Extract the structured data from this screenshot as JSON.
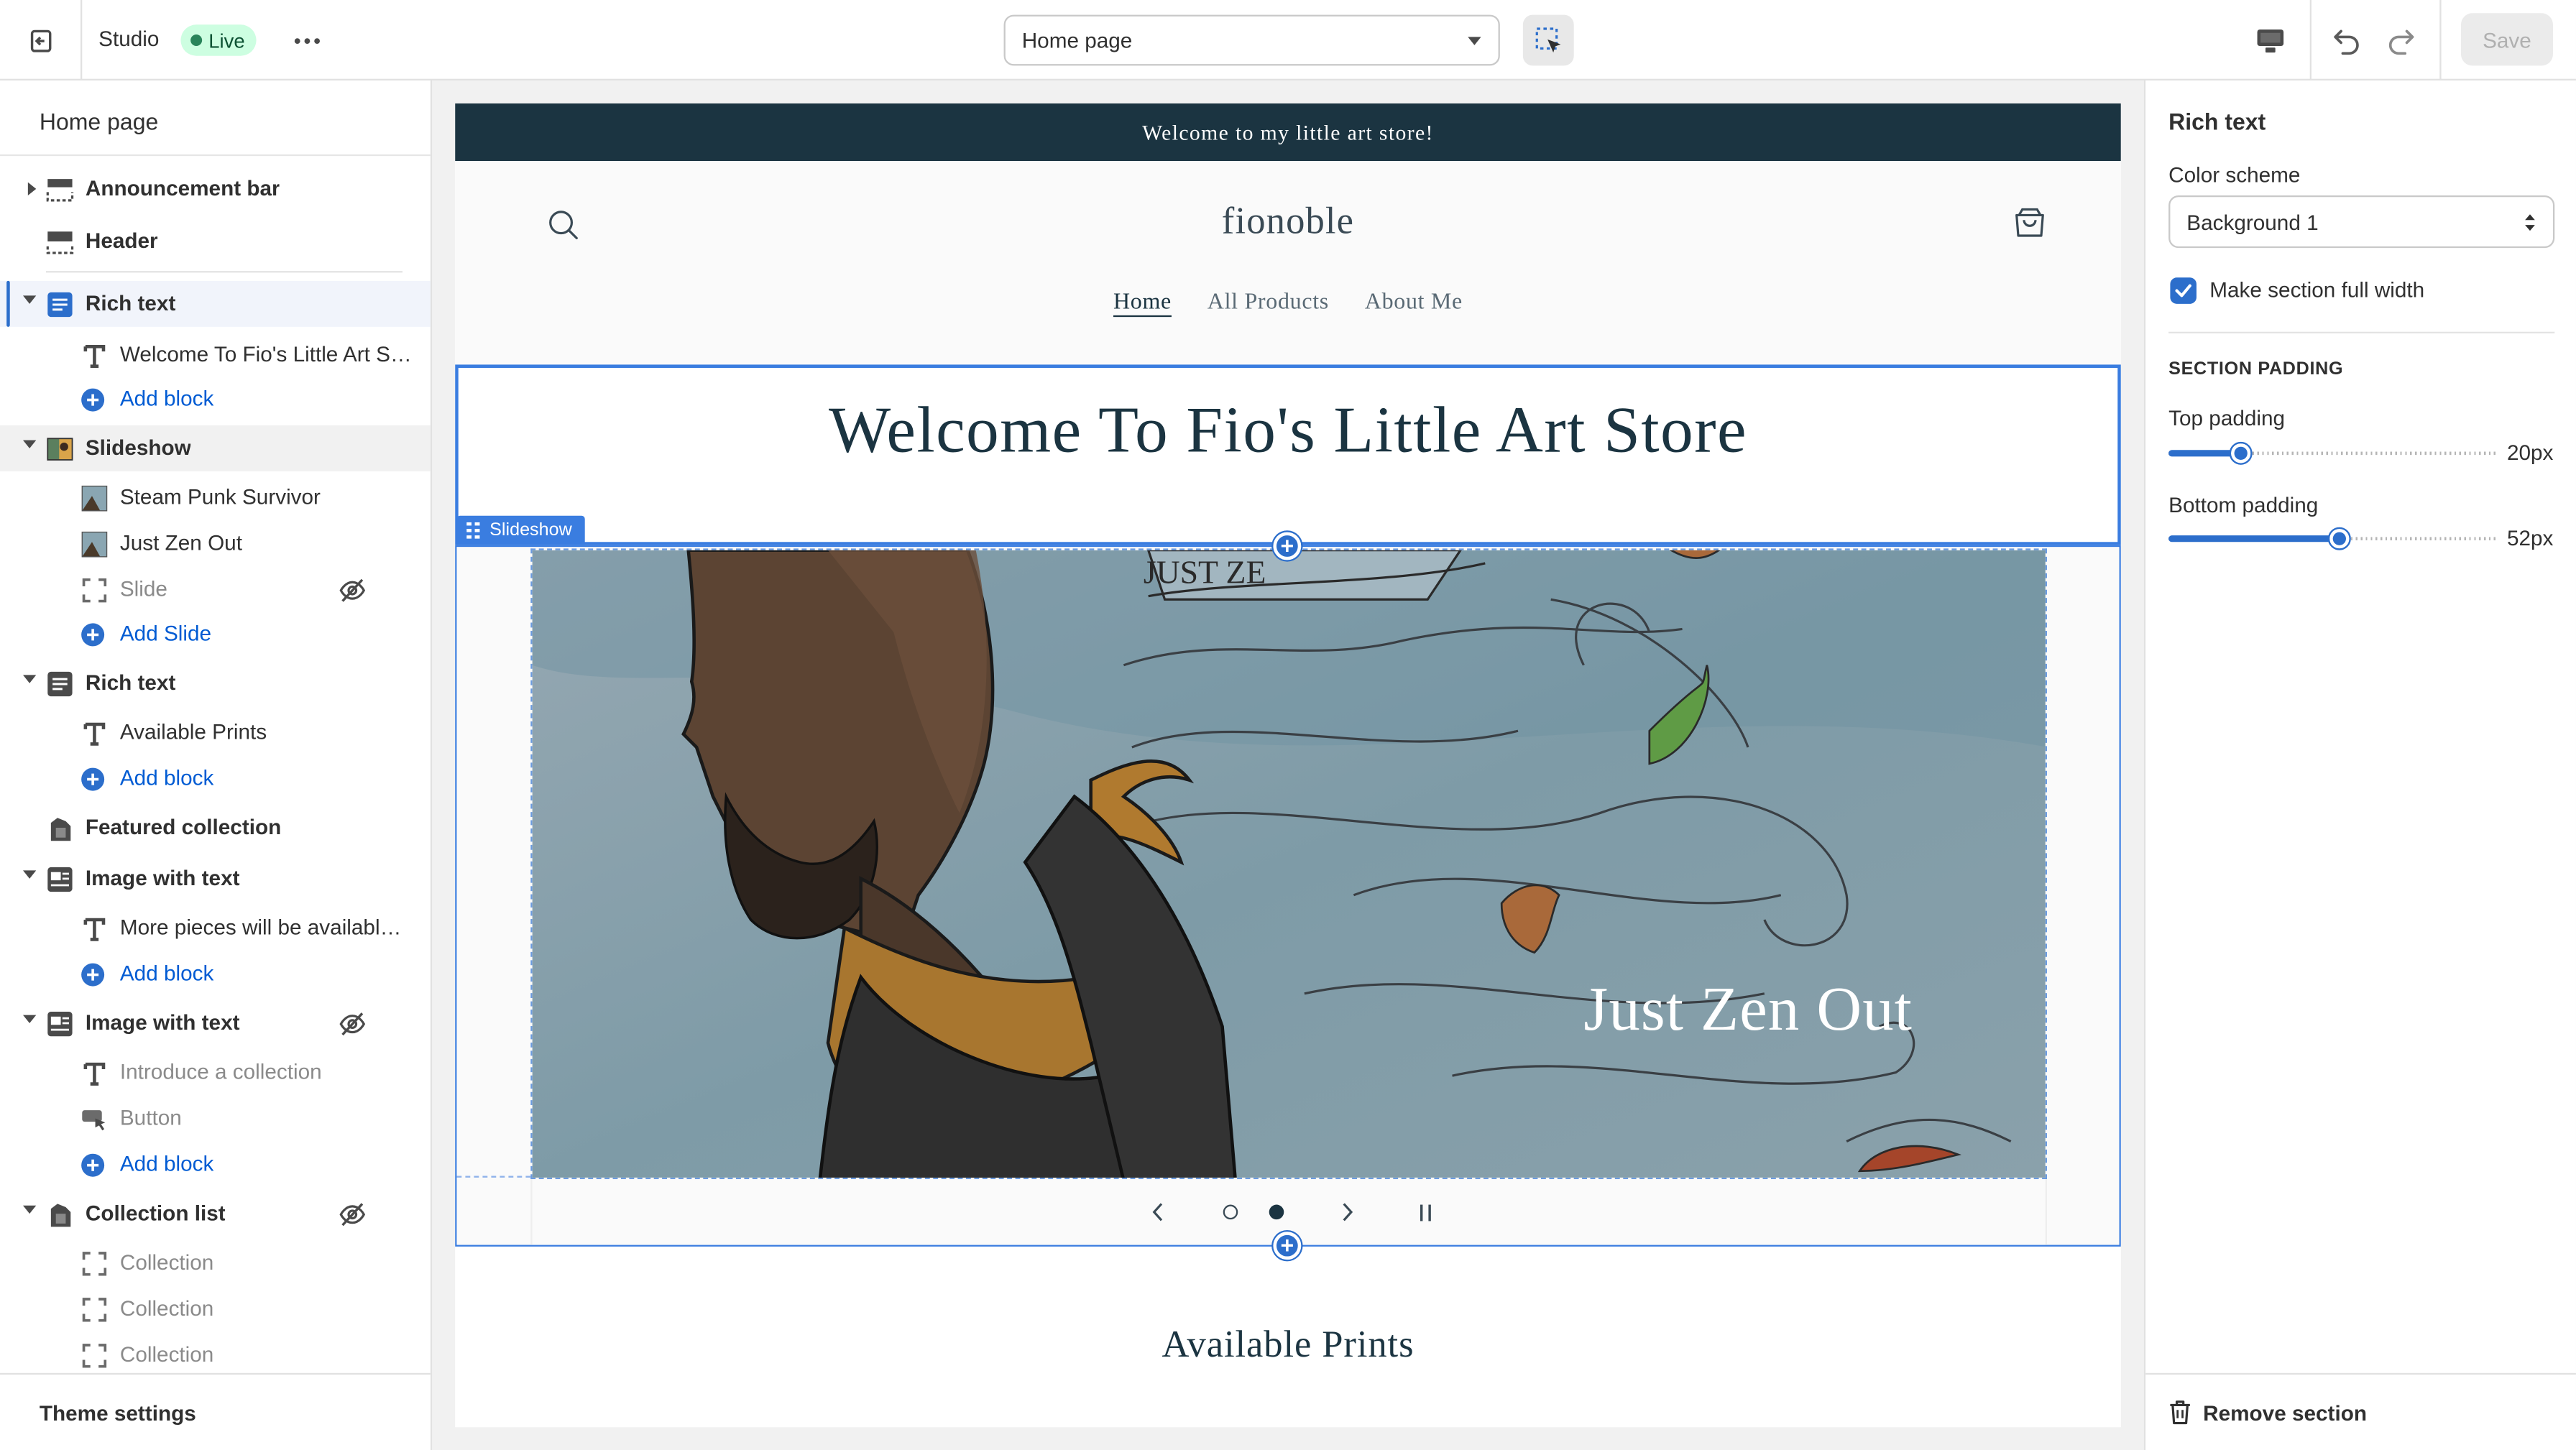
{
  "topbar": {
    "app_name": "Studio",
    "status_badge": "Live",
    "page_select_value": "Home page",
    "save_label": "Save"
  },
  "sidebar": {
    "title": "Home page",
    "footer": "Theme settings",
    "items": [
      {
        "kind": "section",
        "label": "Announcement bar",
        "icon": "layout-top-icon",
        "caret": "right"
      },
      {
        "kind": "section",
        "label": "Header",
        "icon": "layout-header-icon",
        "caret": "none"
      },
      {
        "kind": "section",
        "label": "Rich text",
        "icon": "text-block-icon",
        "caret": "down",
        "selected": true
      },
      {
        "kind": "block",
        "label": "Welcome To Fio's Little Art St...",
        "icon": "text-icon"
      },
      {
        "kind": "add",
        "label": "Add block"
      },
      {
        "kind": "section",
        "label": "Slideshow",
        "icon": "slideshow-icon",
        "caret": "down",
        "hover": true
      },
      {
        "kind": "block",
        "label": "Steam Punk Survivor",
        "icon": "image-thumb-icon"
      },
      {
        "kind": "block",
        "label": "Just Zen Out",
        "icon": "image-thumb-icon"
      },
      {
        "kind": "block",
        "label": "Slide",
        "icon": "placeholder-icon",
        "hidden": true
      },
      {
        "kind": "add",
        "label": "Add Slide"
      },
      {
        "kind": "section",
        "label": "Rich text",
        "icon": "text-block-icon",
        "caret": "down"
      },
      {
        "kind": "block",
        "label": "Available Prints",
        "icon": "text-icon"
      },
      {
        "kind": "add",
        "label": "Add block"
      },
      {
        "kind": "section",
        "label": "Featured collection",
        "icon": "collection-icon",
        "caret": "none"
      },
      {
        "kind": "section",
        "label": "Image with text",
        "icon": "image-text-icon",
        "caret": "down"
      },
      {
        "kind": "block",
        "label": "More pieces will be available ...",
        "icon": "text-icon"
      },
      {
        "kind": "add",
        "label": "Add block"
      },
      {
        "kind": "section",
        "label": "Image with text",
        "icon": "image-text-icon",
        "caret": "down",
        "hidden": true
      },
      {
        "kind": "block",
        "label": "Introduce a collection",
        "icon": "text-icon",
        "hidden": true
      },
      {
        "kind": "block",
        "label": "Button",
        "icon": "button-icon",
        "hidden": true
      },
      {
        "kind": "add",
        "label": "Add block"
      },
      {
        "kind": "section",
        "label": "Collection list",
        "icon": "collection-icon",
        "caret": "down",
        "hidden": true
      },
      {
        "kind": "block",
        "label": "Collection",
        "icon": "placeholder-icon",
        "hidden": true
      },
      {
        "kind": "block",
        "label": "Collection",
        "icon": "placeholder-icon",
        "hidden": true
      },
      {
        "kind": "block",
        "label": "Collection",
        "icon": "placeholder-icon",
        "hidden": true
      }
    ]
  },
  "preview": {
    "announcement": "Welcome to my little art store!",
    "logo": "fionoble",
    "nav": [
      "Home",
      "All Products",
      "About Me"
    ],
    "rich_text_heading": "Welcome To Fio's Little Art Store",
    "slideshow_tag": "Slideshow",
    "slide_fragment": "JUST ZE",
    "slide_caption": "Just Zen Out",
    "available_prints": "Available Prints"
  },
  "inspector": {
    "title": "Rich text",
    "color_scheme_label": "Color scheme",
    "color_scheme_value": "Background 1",
    "full_width_label": "Make section full width",
    "full_width_checked": true,
    "padding_caption": "SECTION PADDING",
    "top_padding_label": "Top padding",
    "top_padding_value": "20px",
    "bottom_padding_label": "Bottom padding",
    "bottom_padding_value": "52px",
    "remove_label": "Remove section"
  },
  "colors": {
    "accent": "#2c6ecb",
    "announcement_bg": "#1b3441",
    "live_badge_bg": "#cdfee1"
  }
}
